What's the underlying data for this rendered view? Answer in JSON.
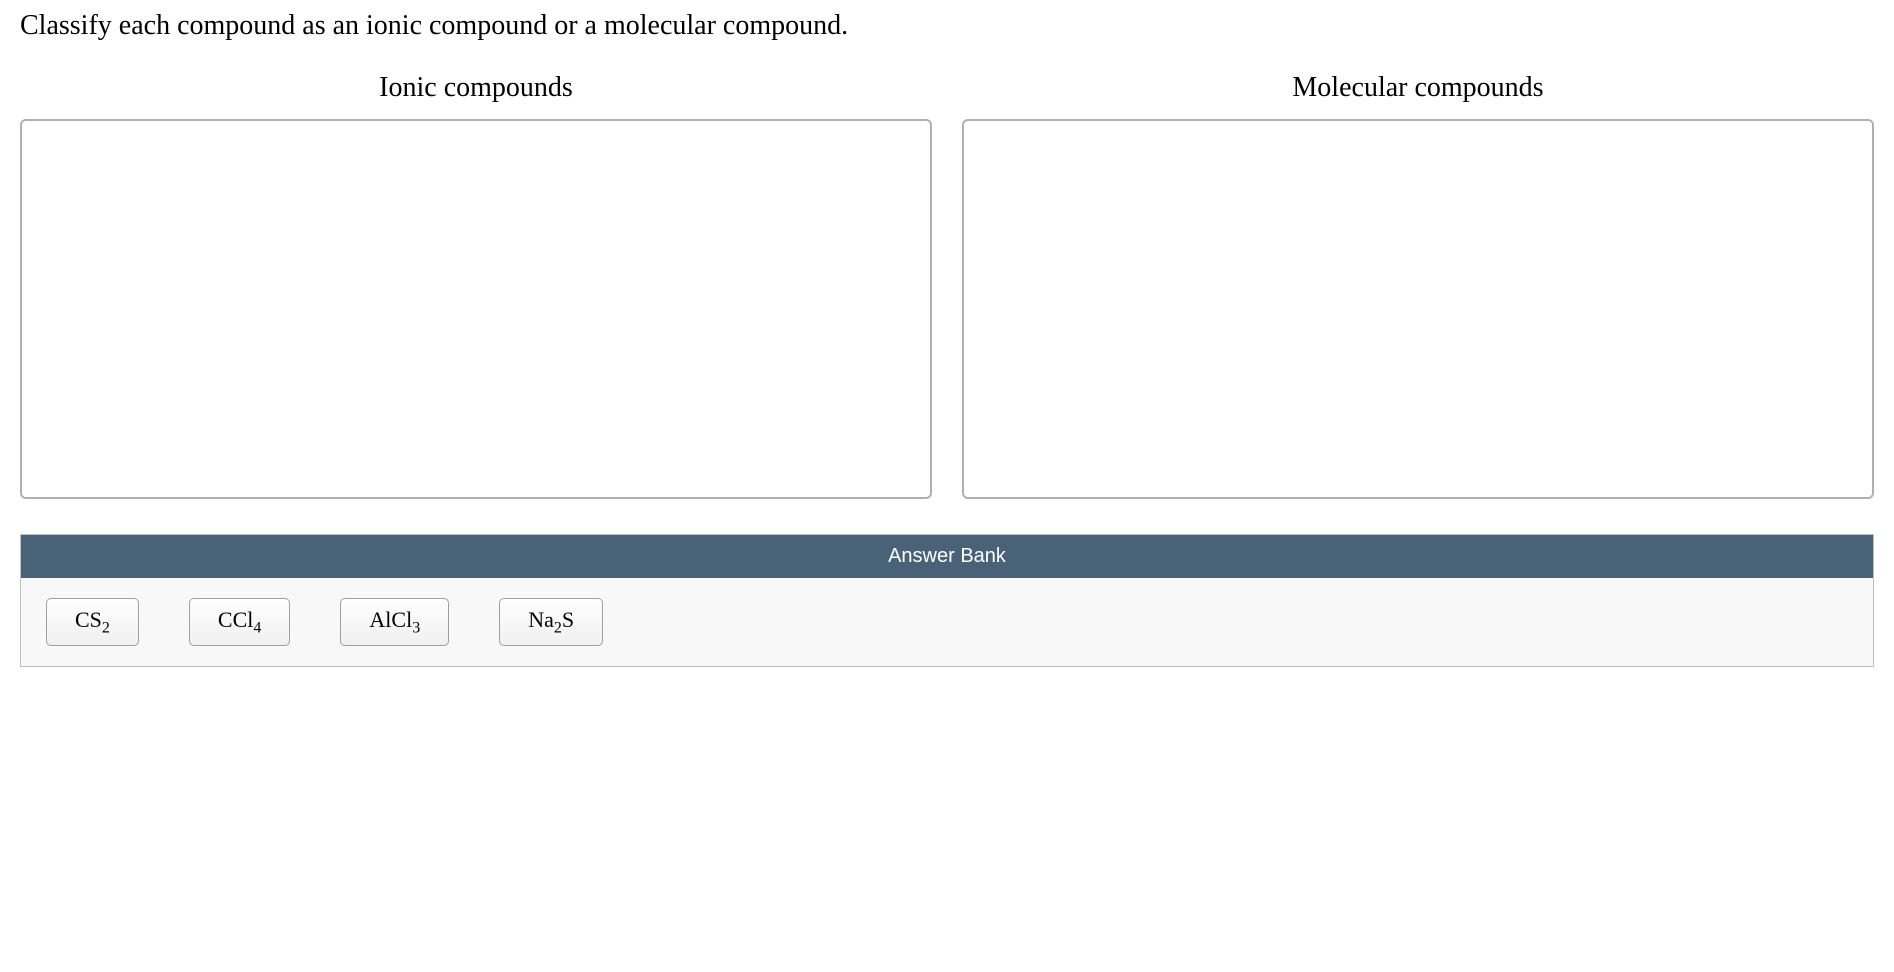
{
  "question": {
    "prompt": "Classify each compound as an ionic compound or a molecular compound."
  },
  "dropZones": {
    "ionic": {
      "title": "Ionic compounds"
    },
    "molecular": {
      "title": "Molecular compounds"
    }
  },
  "answerBank": {
    "header": "Answer Bank",
    "items": [
      {
        "base": "CS",
        "sub": "2"
      },
      {
        "base": "CCl",
        "sub": "4"
      },
      {
        "base": "AlCl",
        "sub": "3"
      },
      {
        "base_pre": "Na",
        "sub_mid": "2",
        "base_post": "S"
      }
    ]
  }
}
